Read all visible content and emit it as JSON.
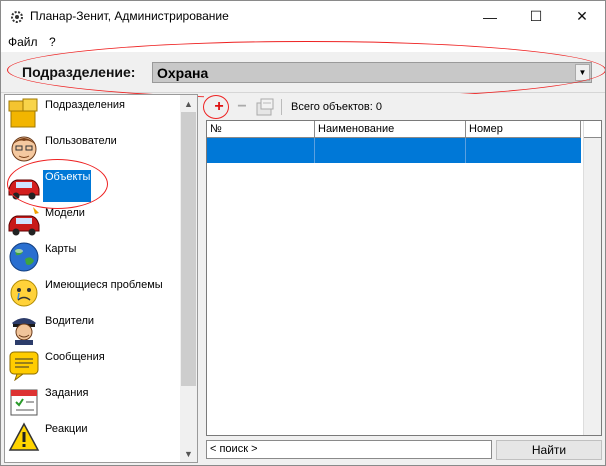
{
  "window": {
    "title": "Планар-Зенит, Администрирование",
    "min": "—",
    "max": "☐",
    "close": "✕"
  },
  "menu": {
    "file": "Файл",
    "help": "?"
  },
  "department": {
    "label": "Подразделение:",
    "value": "Охрана"
  },
  "sidebar": {
    "items": [
      {
        "label": "Подразделения",
        "icon": "folders-icon"
      },
      {
        "label": "Пользователи",
        "icon": "user-face-icon"
      },
      {
        "label": "Объекты",
        "icon": "red-car-icon"
      },
      {
        "label": "Модели",
        "icon": "car-model-icon"
      },
      {
        "label": "Карты",
        "icon": "globe-icon"
      },
      {
        "label": "Имеющиеся проблемы",
        "icon": "sad-face-icon"
      },
      {
        "label": "Водители",
        "icon": "driver-icon"
      },
      {
        "label": "Сообщения",
        "icon": "message-icon"
      },
      {
        "label": "Задания",
        "icon": "calendar-icon"
      },
      {
        "label": "Реакции",
        "icon": "warning-icon"
      }
    ]
  },
  "toolbar": {
    "add": "+",
    "remove": "−",
    "total_label": "Всего объектов: 0"
  },
  "grid": {
    "columns": [
      "№",
      "Наименование",
      "Номер"
    ]
  },
  "bottom": {
    "search": "< поиск >",
    "find_button": "Найти"
  }
}
